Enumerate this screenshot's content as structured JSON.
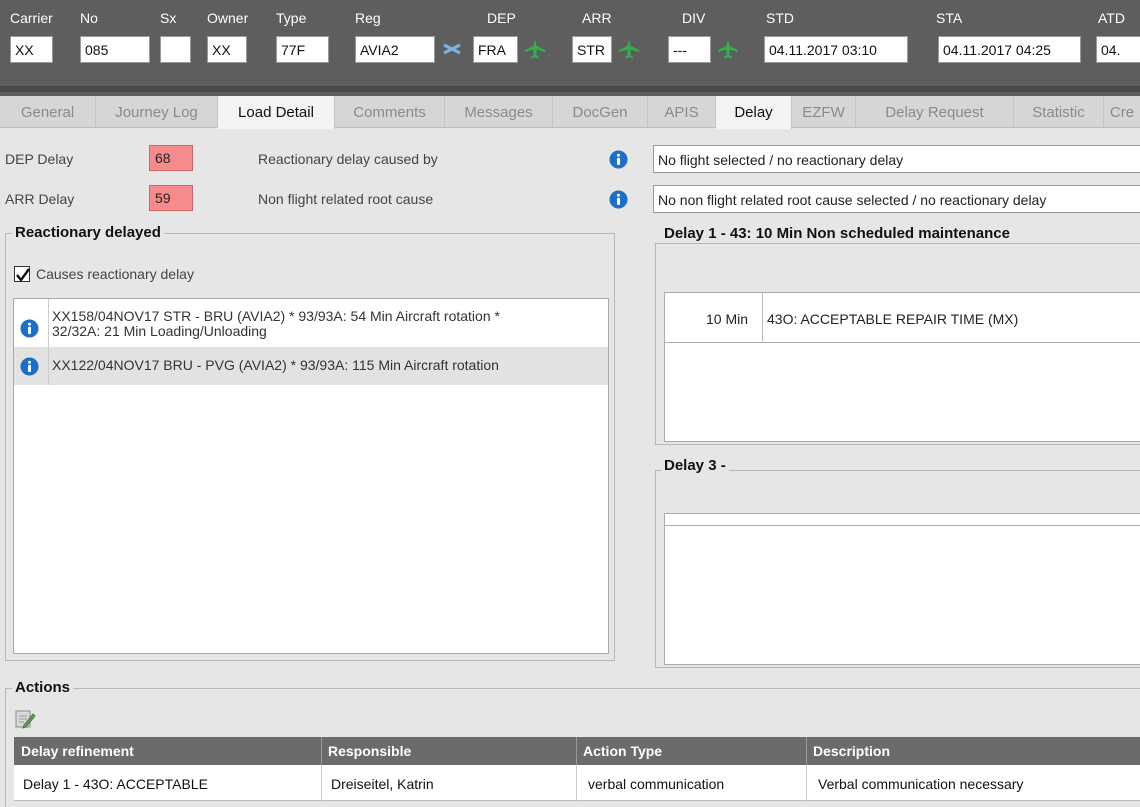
{
  "header": {
    "labels": {
      "carrier": "Carrier",
      "no": "No",
      "sx": "Sx",
      "owner": "Owner",
      "type": "Type",
      "reg": "Reg",
      "dep": "DEP",
      "arr": "ARR",
      "div": "DIV",
      "std": "STD",
      "sta": "STA",
      "atd": "ATD"
    },
    "values": {
      "carrier": "XX",
      "no": "085",
      "sx": "",
      "owner": "XX",
      "type": "77F",
      "reg": "AVIA2",
      "dep": "FRA",
      "arr": "STR",
      "div": "---",
      "std": "04.11.2017 03:10",
      "sta": "04.11.2017 04:25",
      "atd": "04."
    },
    "icons": {
      "reg": "swap-aircraft-icon",
      "airport": "green-airplane-icon"
    }
  },
  "tabs": [
    "General",
    "Journey Log",
    "Load Detail",
    "Comments",
    "Messages",
    "DocGen",
    "APIS",
    "Delay",
    "EZFW",
    "Delay Request",
    "Statistic",
    "Cre"
  ],
  "delays": {
    "dep_label": "DEP Delay",
    "dep_value": "68",
    "arr_label": "ARR Delay",
    "arr_value": "59",
    "reactionary_label": "Reactionary delay caused by",
    "reactionary_value": "No flight selected / no reactionary delay",
    "root_label": "Non flight related root cause",
    "root_value": "No non flight related root cause selected / no reactionary delay"
  },
  "reactionary": {
    "title": "Reactionary delayed",
    "checkbox_label": "Causes reactionary delay",
    "checked": true,
    "items": [
      {
        "line1": "XX158/04NOV17 STR - BRU (AVIA2) * 93/93A: 54 Min Aircraft rotation *",
        "line2": "32/32A: 21 Min Loading/Unloading"
      },
      {
        "line1": "XX122/04NOV17 BRU - PVG (AVIA2) * 93/93A: 115 Min Aircraft rotation",
        "line2": ""
      }
    ]
  },
  "delay1": {
    "title": "Delay 1 - 43: 10 Min Non scheduled maintenance",
    "minutes": "10 Min",
    "code": "43O: ACCEPTABLE REPAIR TIME (MX)"
  },
  "delay3": {
    "title": "Delay 3 -"
  },
  "actions": {
    "title": "Actions",
    "columns": [
      "Delay refinement",
      "Responsible",
      "Action Type",
      "Description"
    ],
    "rows": [
      [
        "Delay 1 - 43O: ACCEPTABLE",
        "Dreiseitel, Katrin",
        "verbal communication",
        "Verbal communication necessary"
      ]
    ]
  },
  "colors": {
    "header_bg": "#5e5e5e",
    "delay_red": "#f78a8a",
    "info_blue": "#1c6fc9",
    "plane_green": "#2db34a"
  }
}
